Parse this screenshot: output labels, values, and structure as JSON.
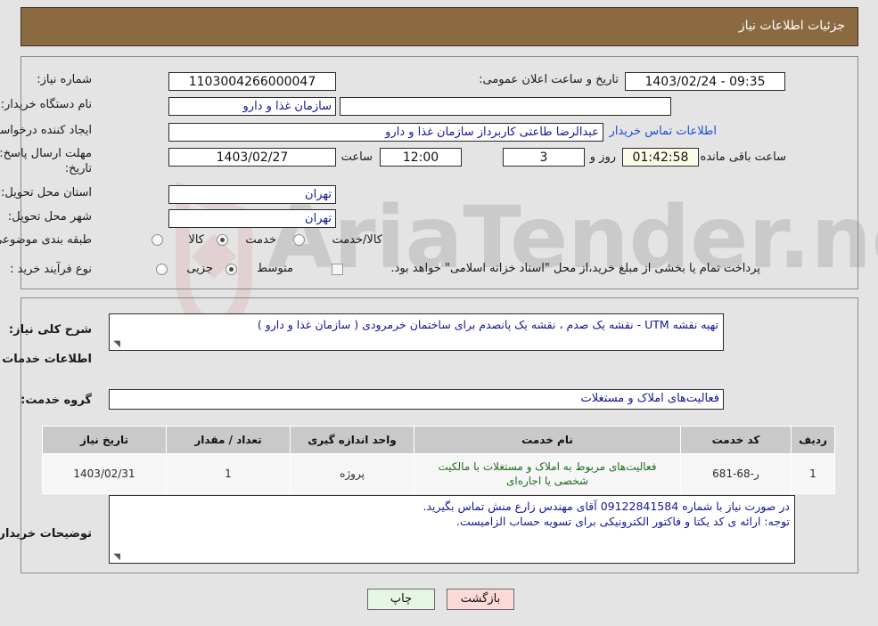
{
  "header": {
    "title": "جزئیات اطلاعات نیاز"
  },
  "top_form": {
    "need_number_label": "شماره نیاز:",
    "need_number_value": "1103004266000047",
    "announce_label": "تاریخ و ساعت اعلان عمومی:",
    "announce_value": "09:35 - 1403/02/24",
    "buyer_org_label": "نام دستگاه خریدار:",
    "buyer_org_value": "سازمان غذا و دارو",
    "buyer_org_secondary_value": "",
    "creator_label": "ایجاد کننده درخواست:",
    "creator_value": "عبدالرضا طاعتی کاربرداز سازمان غذا و دارو",
    "contact_link": "اطلاعات تماس خریدار",
    "deadline_label_line1": "مهلت ارسال پاسخ: تا",
    "deadline_label_line2": "تاریخ:",
    "deadline_date": "1403/02/27",
    "deadline_hour_label": "ساعت",
    "deadline_hour": "12:00",
    "days_remaining": "3",
    "days_label": "روز و",
    "timer": "01:42:58",
    "timer_suffix": "ساعت باقی مانده",
    "province_label": "استان محل تحویل:",
    "province_value": "تهران",
    "city_label": "شهر محل تحویل:",
    "city_value": "تهران",
    "category_label": "طبقه بندی موضوعی:",
    "category_options": [
      "کالا",
      "خدمت",
      "کالا/خدمت"
    ],
    "category_selected": "خدمت",
    "process_label": "نوع فرآیند خرید :",
    "process_options": [
      "جزیی",
      "متوسط"
    ],
    "process_selected": "متوسط",
    "treasury_checkbox_label": "پرداخت تمام یا بخشی از مبلغ خرید،از محل \"اسناد خزانه اسلامی\" خواهد بود.",
    "treasury_checked": false
  },
  "body": {
    "summary_label": "شرح کلی نیاز:",
    "summary_value": "تهیه نقشه UTM - نقشه یک صدم ، نقشه یک پانصدم برای ساختمان خرمرودی ( سازمان غذا و دارو )",
    "services_section_title": "اطلاعات خدمات مورد نیاز",
    "service_group_label": "گروه خدمت:",
    "service_group_value": "فعالیت‌های  املاک و مستغلات",
    "table": {
      "columns": [
        "ردیف",
        "کد خدمت",
        "نام خدمت",
        "واحد اندازه گیری",
        "تعداد / مقدار",
        "تاریخ نیاز"
      ],
      "rows": [
        {
          "row": "1",
          "code": "ر-68-681",
          "name": "فعالیت‌های مربوط به املاک و مستغلات با مالکیت شخصی یا اجاره‌ای",
          "unit": "پروژه",
          "quantity": "1",
          "need_date": "1403/02/31"
        }
      ]
    },
    "buyer_notes_label": "توضیحات خریدار:",
    "buyer_notes_line1": "در صورت نیاز با شماره 09122841584 آقای مهندس زارع منش تماس بگیرید.",
    "buyer_notes_line2": "توجه: ارائه ی کد یکتا و فاکتور الکترونیکی برای تسویه حساب الزامیست."
  },
  "footer": {
    "print_label": "چاپ",
    "back_label": "بازگشت"
  },
  "watermark": {
    "text": "AriaTender.net"
  },
  "colors": {
    "header_bg": "#8b6a41",
    "page_bg": "#e4e4e4",
    "link": "#1b4ed8",
    "field_text": "#14149b",
    "timer_bg": "#fbfbe7",
    "print_btn_bg": "#e6f6e4",
    "back_btn_bg": "#fbdad8"
  }
}
